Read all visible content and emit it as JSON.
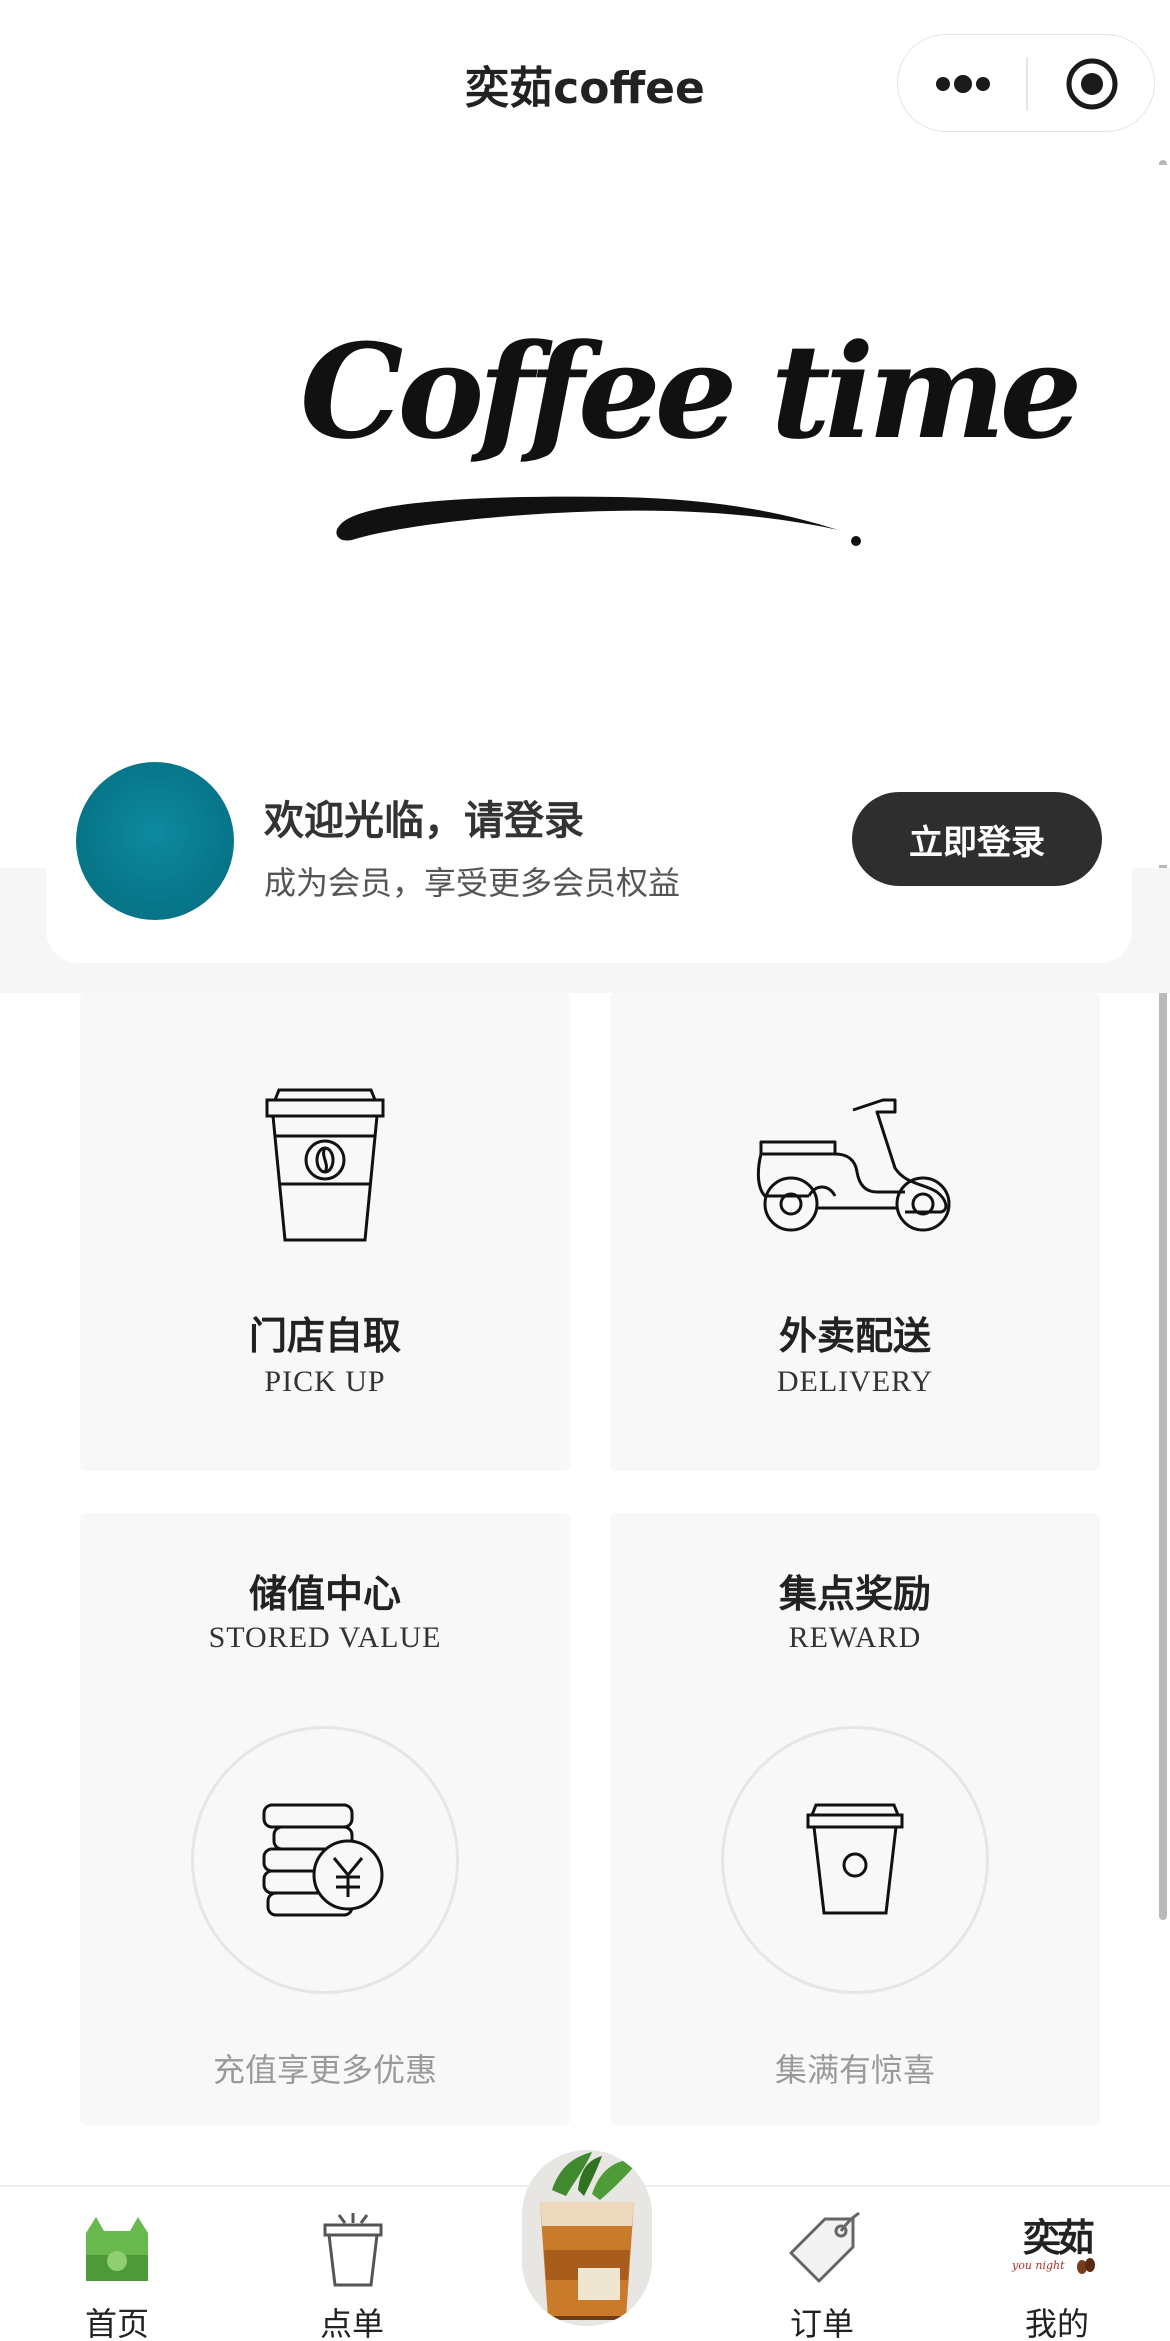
{
  "nav": {
    "title": "奕茹coffee",
    "more_icon": "more-dots-icon",
    "target_icon": "target-icon"
  },
  "banner": {
    "logo_text": "Coffee time"
  },
  "login": {
    "welcome": "欢迎光临，请登录",
    "subtitle": "成为会员，享受更多会员权益",
    "button": "立即登录",
    "avatar_color": "#07768a"
  },
  "tiles": [
    {
      "cn": "门店自取",
      "en": "PICK UP",
      "icon": "coffee-cup-icon"
    },
    {
      "cn": "外卖配送",
      "en": "DELIVERY",
      "icon": "scooter-icon"
    },
    {
      "cn": "储值中心",
      "en": "STORED VALUE",
      "note": "充值享更多优惠",
      "icon": "coins-icon"
    },
    {
      "cn": "集点奖励",
      "en": "REWARD",
      "note": "集满有惊喜",
      "icon": "cup-icon"
    }
  ],
  "tabbar": {
    "items": [
      {
        "label": "首页",
        "icon": "home-icon",
        "active": true
      },
      {
        "label": "点单",
        "icon": "order-cup-icon"
      },
      {
        "label": "",
        "icon": "coffee-photo"
      },
      {
        "label": "订单",
        "icon": "tag-icon"
      },
      {
        "label": "我的",
        "icon": "profile-logo-icon",
        "logo_text": "奕茹",
        "logo_sub": "you night"
      }
    ],
    "active_color": "#5aa844"
  }
}
